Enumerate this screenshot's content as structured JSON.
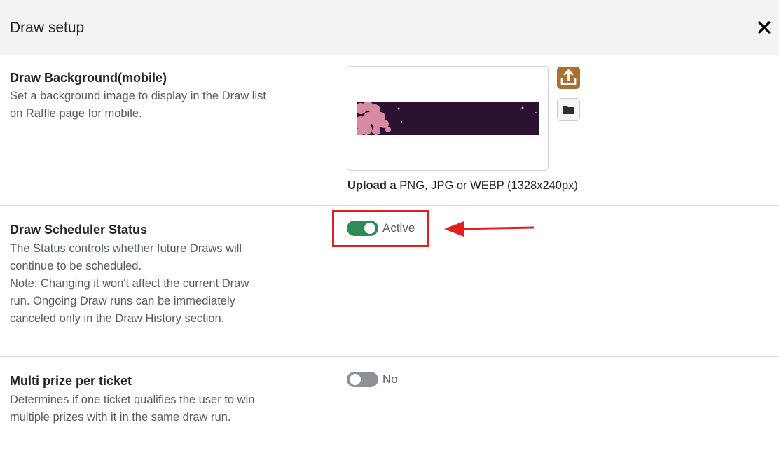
{
  "header": {
    "title": "Draw setup",
    "close_icon": "close-icon"
  },
  "background_section": {
    "title": "Draw Background(mobile)",
    "description": "Set a background image to display in the Draw list on Raffle page for mobile.",
    "upload_hint_bold": "Upload a",
    "upload_hint_rest": " PNG, JPG or WEBP (1328x240px)",
    "upload_icon": "upload-icon",
    "folder_icon": "folder-icon"
  },
  "scheduler_section": {
    "title": "Draw Scheduler Status",
    "description_lines": [
      "The Status controls whether future Draws will continue to be scheduled.",
      "Note: Changing it won't affect the current Draw run. Ongoing Draw runs can be immediately canceled only in the Draw History section."
    ],
    "toggle_on": true,
    "toggle_label": "Active"
  },
  "multi_prize_section": {
    "title": "Multi prize per ticket",
    "description": "Determines if one ticket qualifies the user to win multiple prizes with it in the same draw run.",
    "toggle_on": false,
    "toggle_label": "No"
  },
  "colors": {
    "toggle_on": "#2e8b57",
    "toggle_off": "#8c9196",
    "upload_button": "#a9702f",
    "annotation_red": "#e02020",
    "header_bg": "#f2f3f5"
  }
}
